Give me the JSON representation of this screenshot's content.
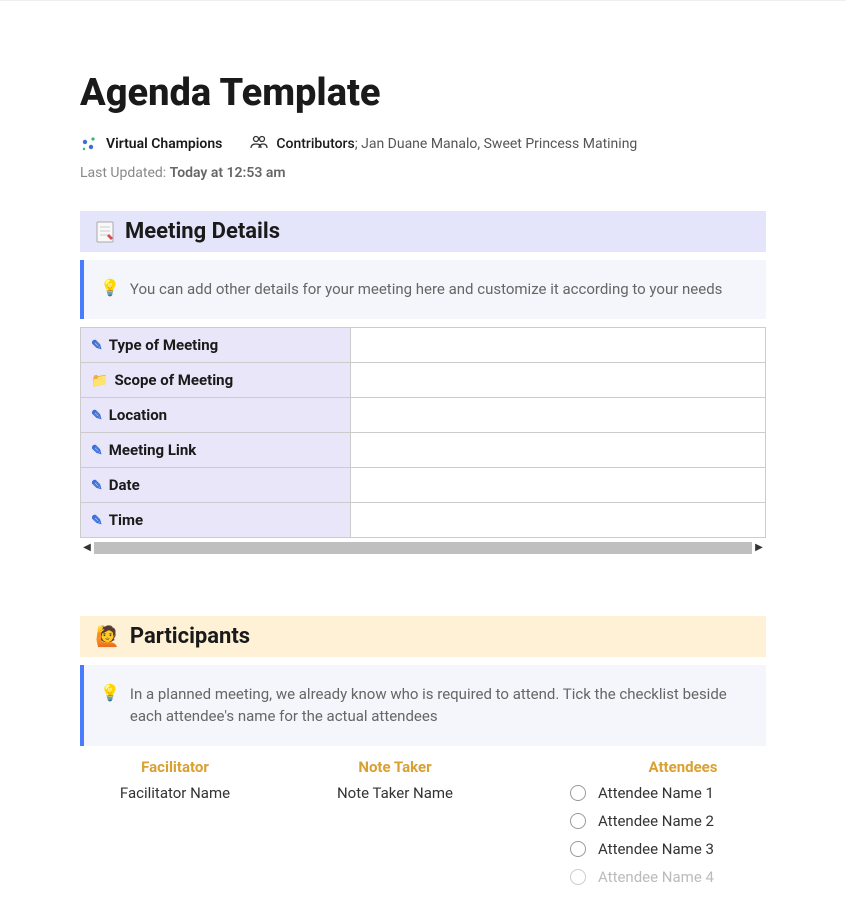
{
  "page": {
    "title": "Agenda Template"
  },
  "meta": {
    "workspace": "Virtual Champions",
    "contributors_label": "Contributors",
    "contributors_names": "; Jan Duane Manalo, Sweet Princess Matining",
    "last_updated_label": "Last Updated: ",
    "last_updated_value": "Today at 12:53 am"
  },
  "meeting_details": {
    "header": "Meeting Details",
    "tip": "You can add other details for your meeting here and customize it according to your needs",
    "rows": [
      {
        "label": "Type of Meeting",
        "value": "",
        "icon": "pen"
      },
      {
        "label": "Scope of Meeting",
        "value": "",
        "icon": "folder"
      },
      {
        "label": "Location",
        "value": "",
        "icon": "pen"
      },
      {
        "label": "Meeting Link",
        "value": "",
        "icon": "pen"
      },
      {
        "label": "Date",
        "value": "",
        "icon": "pen"
      },
      {
        "label": "Time",
        "value": "",
        "icon": "pen"
      }
    ]
  },
  "participants": {
    "header": "Participants",
    "tip": "In a planned meeting, we already know who is required to attend. Tick the checklist beside each attendee's name for the actual attendees",
    "facilitator_header": "Facilitator",
    "facilitator_value": "Facilitator Name",
    "notetaker_header": "Note Taker",
    "notetaker_value": "Note Taker Name",
    "attendees_header": "Attendees",
    "attendees": [
      "Attendee Name 1",
      "Attendee Name 2",
      "Attendee Name 3",
      "Attendee Name 4"
    ]
  }
}
